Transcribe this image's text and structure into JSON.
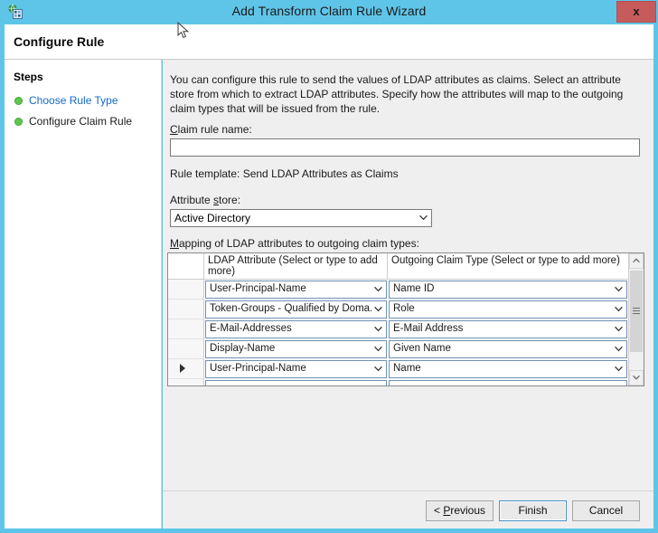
{
  "window": {
    "title": "Add Transform Claim Rule Wizard",
    "icon": "wizard-app-icon",
    "close_label": "x",
    "titlebar_color": "#5fc5e8",
    "close_button_color": "#c75b5b"
  },
  "header": {
    "page_title": "Configure Rule"
  },
  "sidebar": {
    "title": "Steps",
    "items": [
      {
        "label": "Choose Rule Type",
        "style": "link",
        "bullet": "green-dot-icon"
      },
      {
        "label": "Configure Claim Rule",
        "style": "plain",
        "bullet": "green-dot-icon"
      }
    ]
  },
  "main": {
    "intro": "You can configure this rule to send the values of LDAP attributes as claims. Select an attribute store from which to extract LDAP attributes. Specify how the attributes will map to the outgoing claim types that will be issued from the rule.",
    "claim_rule_name": {
      "label_prefix": "C",
      "label_rest": "laim rule name:",
      "value": "",
      "placeholder": ""
    },
    "rule_template": "Rule template: Send LDAP Attributes as Claims",
    "attribute_store": {
      "label_prefix": "Attribute ",
      "label_accel": "s",
      "label_suffix": "tore:",
      "selected": "Active Directory",
      "options": [
        "Active Directory"
      ]
    },
    "mapping_label": {
      "accel": "M",
      "rest": "apping of LDAP attributes to outgoing claim types:"
    },
    "grid": {
      "columns": {
        "gutter": "",
        "ldap": "LDAP Attribute (Select or type to add more)",
        "claim": "Outgoing Claim Type (Select or type to add more)"
      },
      "rows": [
        {
          "marker": false,
          "ldap": "User-Principal-Name",
          "claim": "Name ID"
        },
        {
          "marker": false,
          "ldap": "Token-Groups - Qualified by Doma...",
          "claim": "Role"
        },
        {
          "marker": false,
          "ldap": "E-Mail-Addresses",
          "claim": "E-Mail Address"
        },
        {
          "marker": false,
          "ldap": "Display-Name",
          "claim": "Given Name"
        },
        {
          "marker": true,
          "ldap": "User-Principal-Name",
          "claim": "Name"
        },
        {
          "marker": false,
          "ldap": "",
          "claim": ""
        }
      ],
      "scrollbar": {
        "up_icon": "chevron-up-icon",
        "down_icon": "chevron-down-icon"
      }
    }
  },
  "footer": {
    "previous": {
      "prefix": "< ",
      "accel": "P",
      "rest": "revious"
    },
    "finish": "Finish",
    "cancel": "Cancel"
  }
}
